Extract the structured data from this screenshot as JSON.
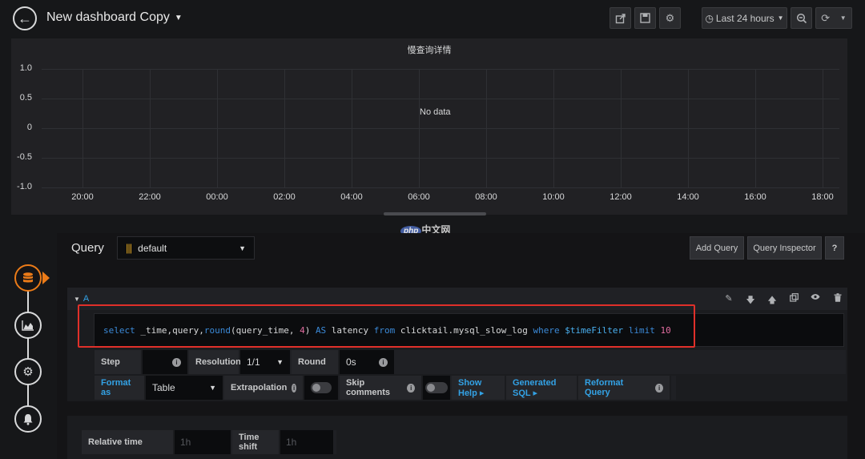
{
  "header": {
    "title": "New dashboard Copy",
    "time_range": "Last 24 hours"
  },
  "panel": {
    "title": "慢查询详情",
    "no_data": "No data"
  },
  "chart_data": {
    "type": "line",
    "title": "慢查询详情",
    "x_ticks": [
      "20:00",
      "22:00",
      "00:00",
      "02:00",
      "04:00",
      "06:00",
      "08:00",
      "10:00",
      "12:00",
      "14:00",
      "16:00",
      "18:00"
    ],
    "y_ticks": [
      "1.0",
      "0.5",
      "0",
      "-0.5",
      "-1.0"
    ],
    "ylim": [
      -1.0,
      1.0
    ],
    "series": [],
    "grid": true
  },
  "query_editor": {
    "label": "Query",
    "datasource": "default",
    "add_query": "Add Query",
    "query_inspector": "Query Inspector",
    "help": "?"
  },
  "query_a": {
    "ref_id": "A",
    "sql_tokens": [
      {
        "t": "select",
        "c": "kw"
      },
      {
        "t": " _time,query,",
        "c": "plain"
      },
      {
        "t": "round",
        "c": "kw"
      },
      {
        "t": "(query_time, ",
        "c": "plain"
      },
      {
        "t": "4",
        "c": "num"
      },
      {
        "t": ") ",
        "c": "plain"
      },
      {
        "t": "AS",
        "c": "kw"
      },
      {
        "t": " latency ",
        "c": "plain"
      },
      {
        "t": "from",
        "c": "kw"
      },
      {
        "t": " clicktail.mysql_slow_log ",
        "c": "plain"
      },
      {
        "t": "where",
        "c": "kw"
      },
      {
        "t": " ",
        "c": "plain"
      },
      {
        "t": "$timeFilter",
        "c": "var"
      },
      {
        "t": " ",
        "c": "plain"
      },
      {
        "t": "limit",
        "c": "kw"
      },
      {
        "t": " ",
        "c": "plain"
      },
      {
        "t": "10",
        "c": "num"
      }
    ],
    "step_label": "Step",
    "resolution_label": "Resolution",
    "resolution_value": "1/1",
    "round_label": "Round",
    "round_value": "0s",
    "format_as_label": "Format as",
    "format_as_value": "Table",
    "extrapolation_label": "Extrapolation",
    "skip_comments_label": "Skip comments",
    "show_help": "Show Help ▸",
    "generated_sql": "Generated SQL ▸",
    "reformat_query": "Reformat Query"
  },
  "time_options": {
    "relative_time_label": "Relative time",
    "relative_time_placeholder": "1h",
    "time_shift_label": "Time shift",
    "time_shift_placeholder": "1h"
  },
  "watermark": {
    "badge": "php",
    "text": "中文网"
  },
  "icons": {
    "back": "arrow-left-icon",
    "share": "share-icon",
    "save": "save-icon",
    "settings": "gear-icon",
    "clock": "clock-icon",
    "zoom_out": "zoom-out-icon",
    "refresh": "refresh-icon"
  },
  "colors": {
    "accent_orange": "#eb7b18",
    "link_blue": "#33a2e5",
    "highlight_red": "#e0302a"
  }
}
